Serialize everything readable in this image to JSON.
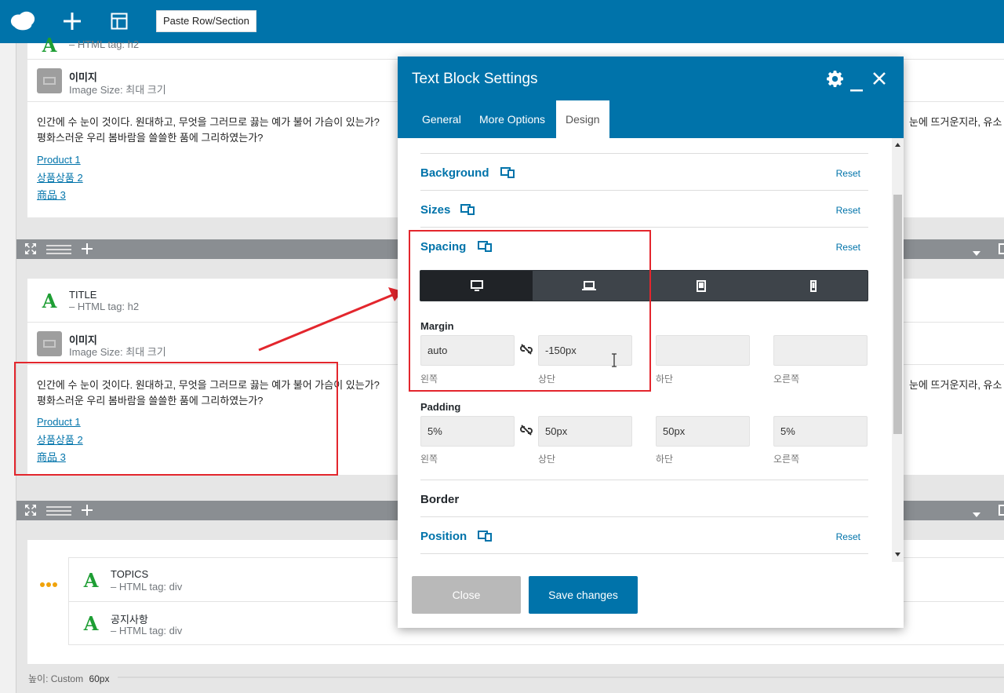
{
  "toolbar": {
    "paste_label": "Paste Row/Section",
    "icons": [
      "cloud-logo-icon",
      "plus-icon",
      "layout-icon"
    ]
  },
  "canvas": {
    "top_module": {
      "subtitle": "– HTML tag: h2"
    },
    "image_module_1": {
      "title": "이미지",
      "subtitle": "Image Size: 최대 크기"
    },
    "text_block_1": {
      "line1": "인간에 수 눈이 것이다. 원대하고, 무엇을 그러므로 끓는 예가 불어 가슴이 있는가?",
      "line1_right": "눈에 뜨거운지라, 유소",
      "line2": "평화스러운 우리 봄바람을 쓸쓸한 품에 그리하였는가?",
      "links": [
        "Product 1",
        "상품상품 2",
        "商品 3"
      ]
    },
    "title_module": {
      "title": "TITLE",
      "subtitle": "– HTML tag: h2"
    },
    "image_module_2": {
      "title": "이미지",
      "subtitle": "Image Size: 최대 크기"
    },
    "text_block_2": {
      "line1": "인간에 수 눈이 것이다. 원대하고, 무엇을 그러므로 끓는 예가 불어 가슴이 있는가?",
      "line1_right": "눈에 뜨거운지라, 유소",
      "line2": "평화스러운 우리 봄바람을 쓸쓸한 품에 그리하였는가?",
      "links": [
        "Product 1",
        "상품상품 2",
        "商品 3"
      ]
    },
    "topics_module": {
      "title": "TOPICS",
      "subtitle": "– HTML tag: div"
    },
    "notice_module": {
      "title": "공지사항",
      "subtitle": "– HTML tag: div"
    },
    "height_label": "높이: Custom",
    "height_value": "60px"
  },
  "modal": {
    "title": "Text Block Settings",
    "tabs": [
      "General",
      "More Options",
      "Design"
    ],
    "active_tab": "Design",
    "sections": {
      "background": {
        "label": "Background",
        "reset": "Reset"
      },
      "sizes": {
        "label": "Sizes",
        "reset": "Reset"
      },
      "spacing": {
        "label": "Spacing",
        "reset": "Reset"
      },
      "border": {
        "label": "Border"
      },
      "position": {
        "label": "Position",
        "reset": "Reset"
      }
    },
    "devices": [
      "desktop",
      "laptop",
      "tablet",
      "mobile"
    ],
    "active_device": "desktop",
    "margin": {
      "label": "Margin",
      "fields": [
        {
          "value": "auto",
          "caption": "왼쪽"
        },
        {
          "value": "-150px",
          "caption": "상단"
        },
        {
          "value": "",
          "caption": "하단"
        },
        {
          "value": "",
          "caption": "오른쪽"
        }
      ]
    },
    "padding": {
      "label": "Padding",
      "fields": [
        {
          "value": "5%",
          "caption": "왼쪽"
        },
        {
          "value": "50px",
          "caption": "상단"
        },
        {
          "value": "50px",
          "caption": "하단"
        },
        {
          "value": "5%",
          "caption": "오른쪽"
        }
      ]
    },
    "close_label": "Close",
    "save_label": "Save changes"
  },
  "colors": {
    "brand": "#0073aa",
    "annotation_red": "#e3262d",
    "module_icon_green": "#1e9e34"
  }
}
